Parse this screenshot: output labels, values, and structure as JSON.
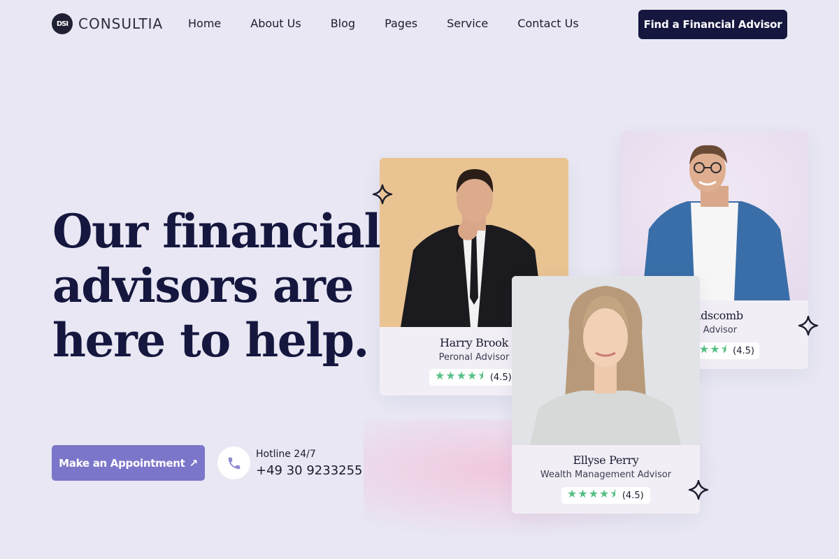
{
  "brand": {
    "name": "CONSULTIA",
    "mark": "DSI"
  },
  "nav": {
    "items": [
      "Home",
      "About Us",
      "Blog",
      "Pages",
      "Service",
      "Contact Us"
    ],
    "cta": "Find a Financial Advisor"
  },
  "hero": {
    "title_lines": [
      "Our financial",
      "advisors are",
      "here to help."
    ],
    "appointment_label": "Make an Appointment",
    "appointment_icon": "arrow-up-right-icon",
    "hotline_label": "Hotline 24/7",
    "hotline_number": "+49 30 9233255"
  },
  "advisors": [
    {
      "name": "Harry Brook",
      "role": "Peronal Advisor",
      "stars": "★★★★⯨",
      "rating": "(4.5)"
    },
    {
      "name": "Handscomb",
      "role": "onal Advisor",
      "stars": "★★⯨",
      "rating": "(4.5)"
    },
    {
      "name": "Ellyse Perry",
      "role": "Wealth Management Advisor",
      "stars": "★★★★⯨",
      "rating": "(4.5)"
    }
  ],
  "colors": {
    "background": "#e8e7f3",
    "navy": "#15173f",
    "accent": "#7b76c9",
    "star": "#57c085"
  }
}
